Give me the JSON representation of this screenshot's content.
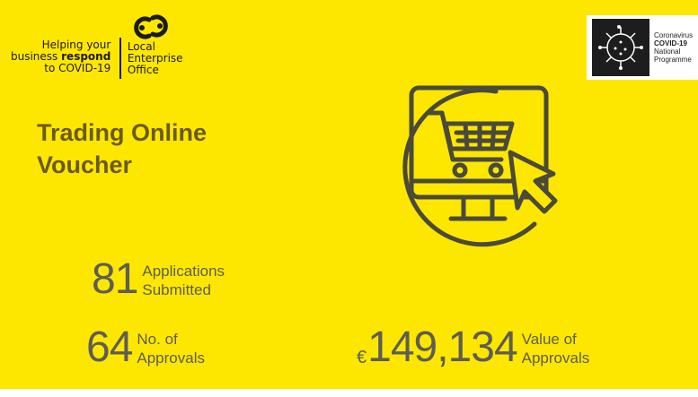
{
  "branding": {
    "tagline_line1": "Helping your",
    "tagline_line2_plain": "business",
    "tagline_line2_bold": "respond",
    "tagline_line3": "to COVID-19",
    "leo_line1": "Local",
    "leo_line2": "Enterprise",
    "leo_line3": "Office"
  },
  "covid_badge": {
    "line1": "Coronavirus",
    "line2": "COVID-19",
    "line3": "National",
    "line4": "Programme"
  },
  "title": {
    "line1": "Trading Online",
    "line2": "Voucher"
  },
  "stats": {
    "applications": {
      "value": "81",
      "label_line1": "Applications",
      "label_line2": "Submitted"
    },
    "approvals": {
      "value": "64",
      "label_line1": "No. of",
      "label_line2": "Approvals"
    },
    "approval_value": {
      "currency": "€",
      "value": "149,134",
      "label_line1": "Value of",
      "label_line2": "Approvals"
    }
  },
  "colors": {
    "background": "#fde700",
    "title": "#6a5a1a",
    "stat_text": "#5e5d55",
    "icon_stroke": "#4a4a3a"
  },
  "icons": {
    "leo_logo": "interlocking-rings-logo",
    "covid": "virus-icon",
    "main": "shopping-cart-monitor-icon"
  }
}
